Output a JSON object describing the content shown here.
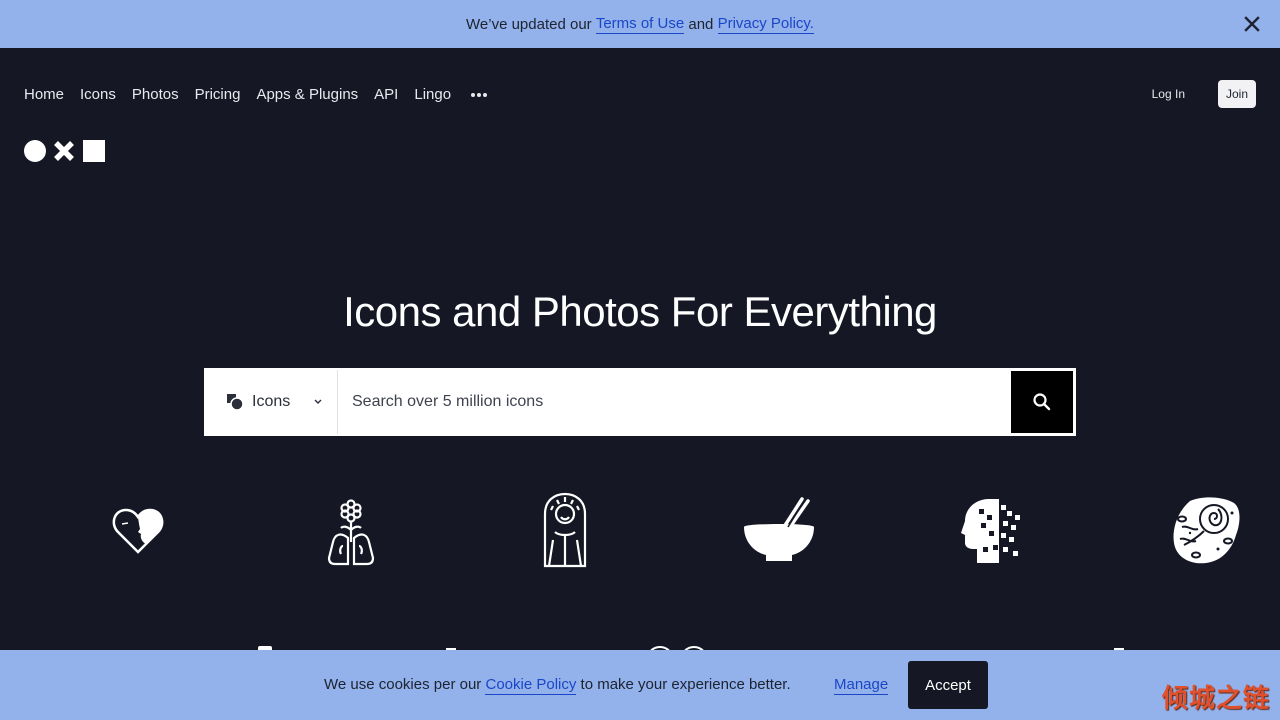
{
  "top_banner": {
    "prefix": "We’ve updated our ",
    "terms_link": "Terms of Use",
    "middle": " and ",
    "privacy_link": "Privacy Policy.",
    "close_icon": "close-icon"
  },
  "nav": {
    "links": [
      "Home",
      "Icons",
      "Photos",
      "Pricing",
      "Apps & Plugins",
      "API",
      "Lingo"
    ],
    "more_icon": "more-horizontal-icon",
    "login": "Log In",
    "join": "Join"
  },
  "logo": {
    "shapes": [
      "circle",
      "x",
      "square"
    ]
  },
  "hero": {
    "title": "Icons and Photos For Everything"
  },
  "search": {
    "type_label": "Icons",
    "type_icon": "icons-type-icon",
    "placeholder": "Search over 5 million icons",
    "value": "",
    "button_icon": "search-icon"
  },
  "featured_icons": [
    {
      "name": "heart-face-icon"
    },
    {
      "name": "flower-lungs-icon"
    },
    {
      "name": "woman-veil-icon"
    },
    {
      "name": "bowl-chopsticks-icon"
    },
    {
      "name": "pixel-head-icon"
    },
    {
      "name": "fossil-stone-icon"
    }
  ],
  "cookie_banner": {
    "prefix": "We use cookies per our ",
    "policy_link": "Cookie Policy",
    "suffix": " to make your experience better.",
    "manage": "Manage",
    "accept": "Accept"
  },
  "watermark": "倾城之链",
  "colors": {
    "background": "#151824",
    "banner": "#93b2ec",
    "link": "#1b46c7",
    "accept_button": "#151824"
  }
}
